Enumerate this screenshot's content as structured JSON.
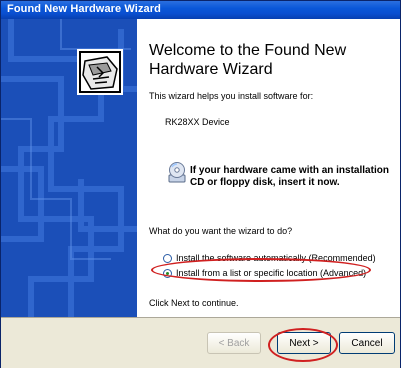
{
  "window": {
    "title": "Found New Hardware Wizard"
  },
  "content": {
    "heading": "Welcome to the Found New Hardware Wizard",
    "intro": "This wizard helps you install software for:",
    "device_name": "RK28XX Device",
    "cd_notice": "If your hardware came with an installation CD or floppy disk, insert it now.",
    "question": "What do you want the wizard to do?",
    "options": [
      {
        "label": "Install the software automatically (Recommended)",
        "selected": false
      },
      {
        "label": "Install from a list or specific location (Advanced)",
        "selected": true
      }
    ],
    "continue_hint": "Click Next to continue."
  },
  "buttons": {
    "back": "< Back",
    "next": "Next >",
    "cancel": "Cancel"
  },
  "colors": {
    "titlebar": "#0a57d8",
    "banner": "#1b4fb8",
    "highlight": "#d02020",
    "footer": "#ece9d8"
  },
  "icons": {
    "wizard": "hardware-wizard-icon",
    "cd": "cd-icon"
  }
}
